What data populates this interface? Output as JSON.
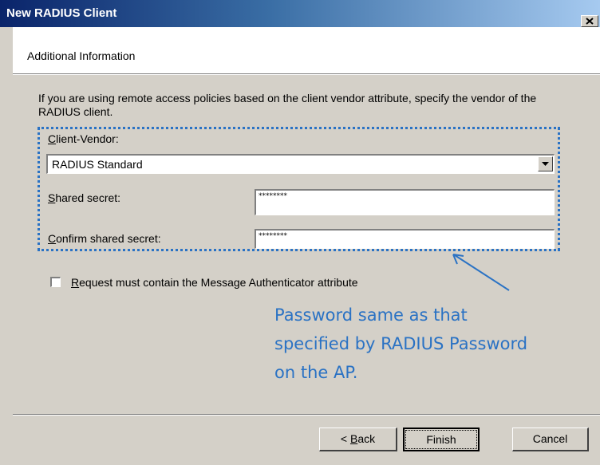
{
  "window": {
    "title": "New RADIUS Client"
  },
  "header": {
    "title": "Additional Information"
  },
  "intro_text": "If you are using remote access policies based on the client vendor attribute, specify the vendor of the RADIUS client.",
  "client_vendor": {
    "label_prefix": "",
    "label_access": "C",
    "label_rest": "lient-Vendor:",
    "value": "RADIUS Standard"
  },
  "shared_secret": {
    "label_access": "S",
    "label_rest": "hared secret:",
    "value": "********"
  },
  "confirm_secret": {
    "label_access": "C",
    "label_rest": "onfirm shared secret:",
    "value": "********"
  },
  "message_auth": {
    "label_access": "R",
    "label_rest": "equest must contain the Message Authenticator attribute",
    "checked": false
  },
  "annotation": {
    "line1": "Password same as that",
    "line2": "specified by RADIUS Password",
    "line3": "on the AP."
  },
  "buttons": {
    "back_prefix": "< ",
    "back_access": "B",
    "back_rest": "ack",
    "finish": "Finish",
    "cancel": "Cancel"
  },
  "colors": {
    "annotation": "#2a72c4",
    "titlebar": "#0a246a"
  },
  "icons": {
    "close": "close-icon",
    "dropdown": "chevron-down-icon"
  }
}
